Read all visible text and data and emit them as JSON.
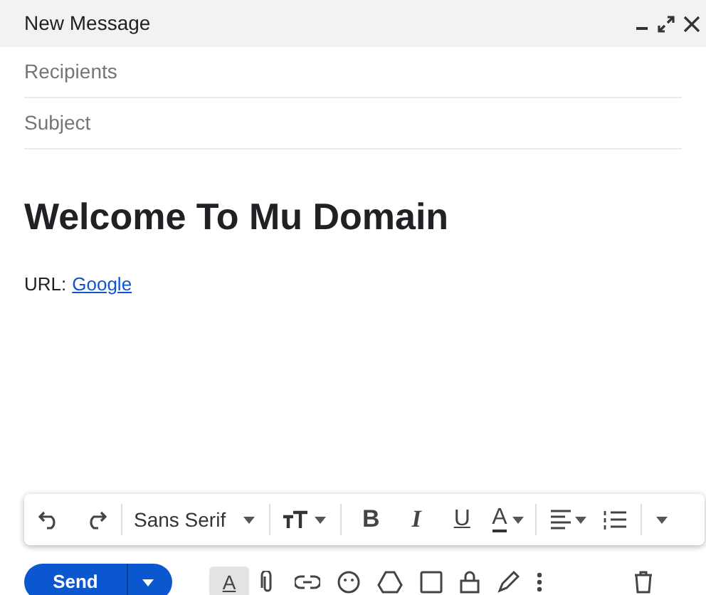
{
  "window": {
    "title": "New Message"
  },
  "recipients": {
    "placeholder": "Recipients"
  },
  "subject": {
    "placeholder": "Subject"
  },
  "body": {
    "heading": "Welcome To Mu Domain",
    "url_label": "URL:",
    "link": "Google"
  },
  "format_toolbar": {
    "font": "Sans Serif",
    "bold": "B",
    "italic": "I",
    "underline": "U",
    "text_color": "A"
  },
  "bottom_bar": {
    "send": "Send",
    "formatting_toggle": "A"
  }
}
